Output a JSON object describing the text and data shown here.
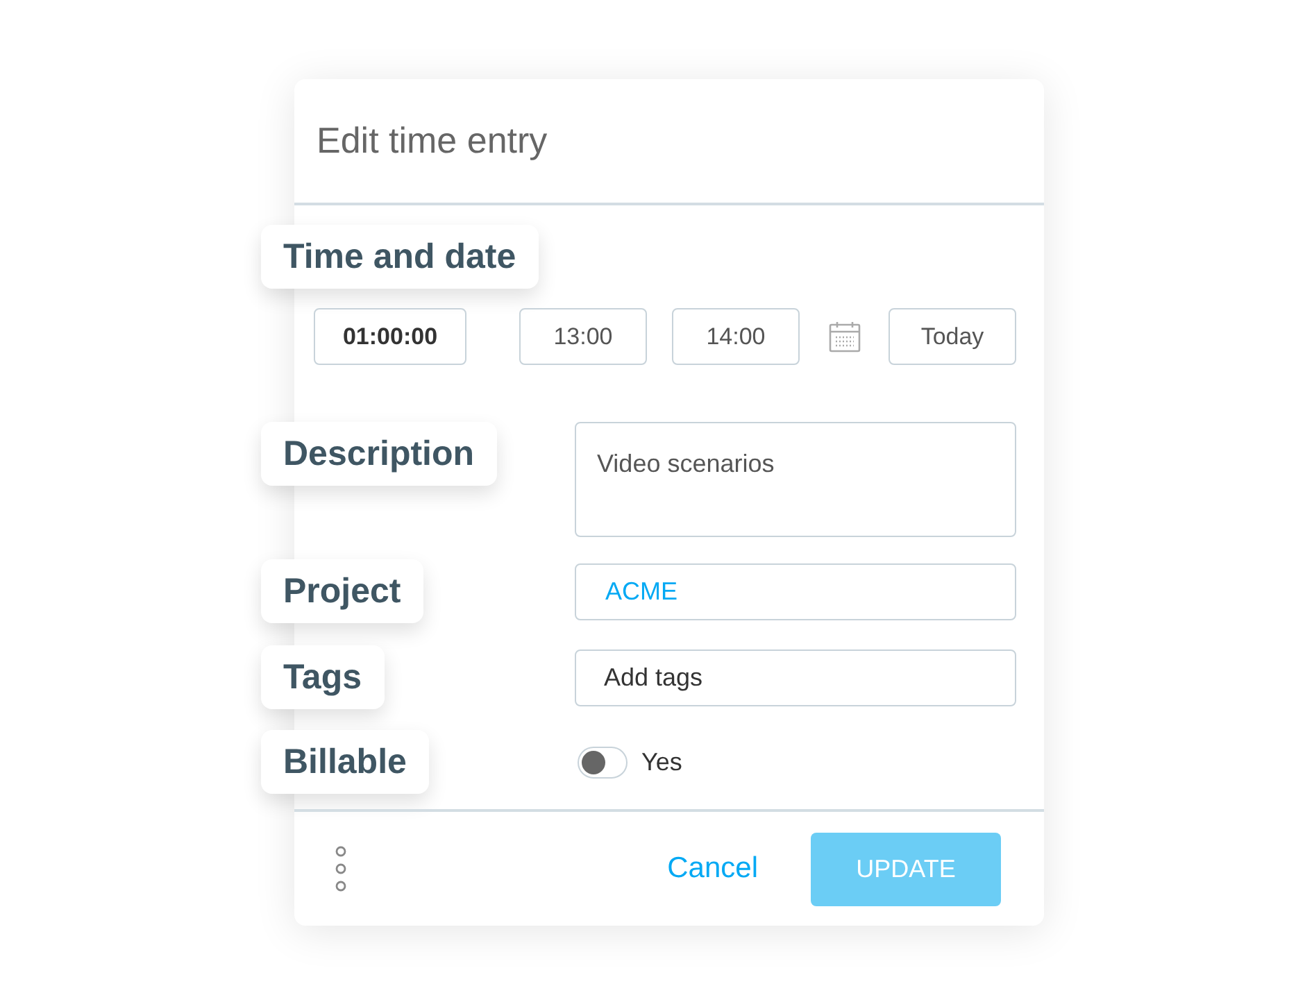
{
  "dialog": {
    "title": "Edit time entry"
  },
  "time_and_date": {
    "label": "Time and date",
    "duration": "01:00:00",
    "start": "13:00",
    "end": "14:00",
    "date_button": "Today"
  },
  "description": {
    "label": "Description",
    "value": "Video scenarios"
  },
  "project": {
    "label": "Project",
    "value": "ACME"
  },
  "tags": {
    "label": "Tags",
    "placeholder": "Add tags"
  },
  "billable": {
    "label": "Billable",
    "on": false,
    "option_label": "Yes"
  },
  "footer": {
    "cancel": "Cancel",
    "submit": "UPDATE"
  }
}
